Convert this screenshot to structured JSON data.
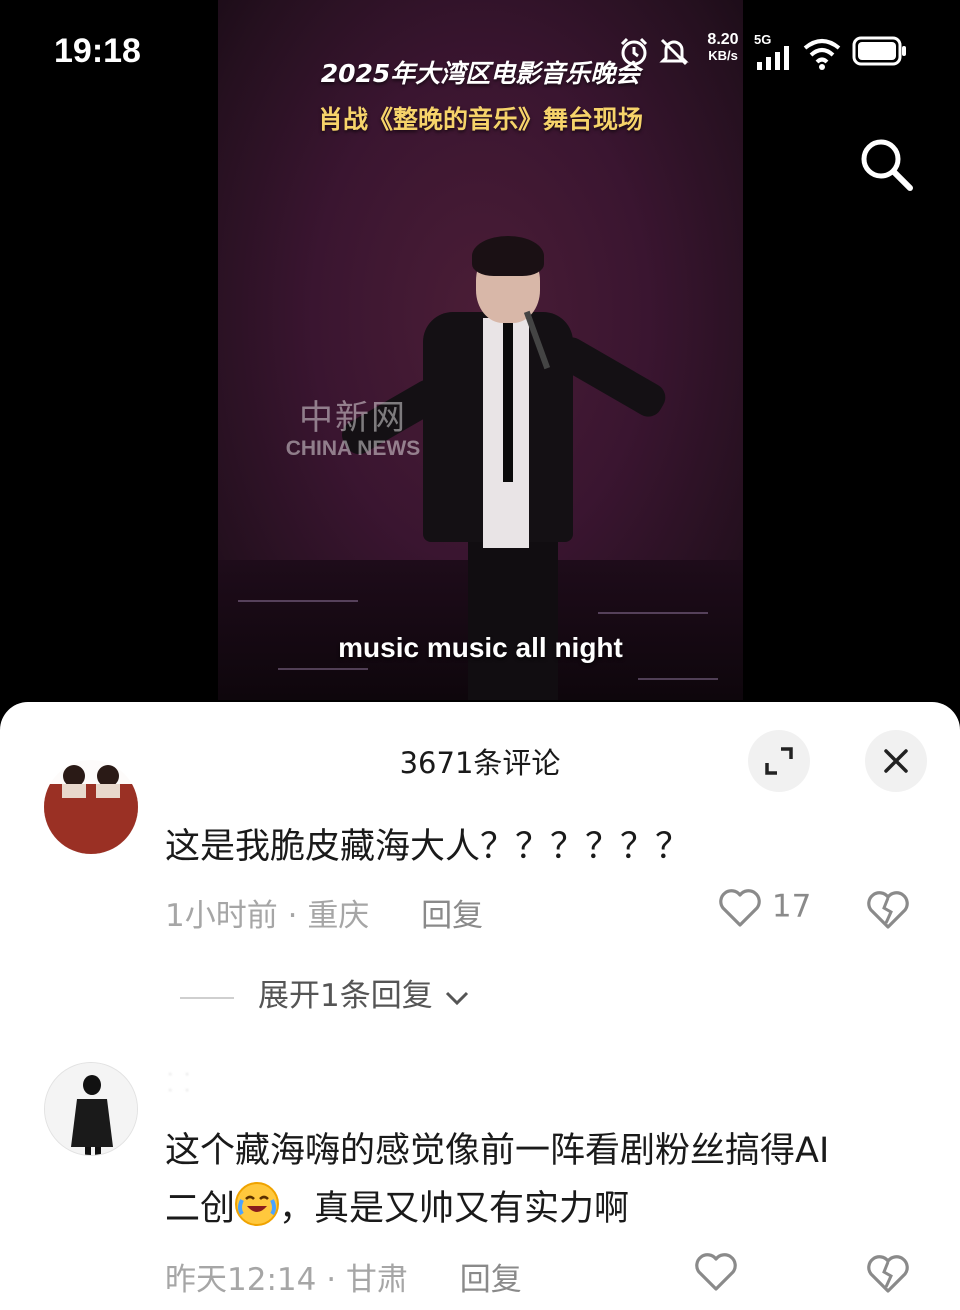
{
  "status_bar": {
    "time": "19:18",
    "net_speed_value": "8.20",
    "net_speed_unit": "KB/s",
    "network": "5G",
    "icons": [
      "alarm-icon",
      "mute-icon",
      "signal-icon",
      "wifi-icon",
      "battery-icon"
    ]
  },
  "video": {
    "title_line1": "2025年大湾区电影音乐晚会",
    "title_line2": "肖战《整晚的音乐》舞台现场",
    "watermark_cn": "中新网",
    "watermark_en": "CHINA NEWS",
    "subtitle": "music music all night",
    "title_colors": {
      "line1": "#ffffff",
      "line2": "#f6d36a"
    }
  },
  "comments_panel": {
    "title": "3671条评论",
    "expand_icon": "expand-icon",
    "close_icon": "close-icon",
    "comments": [
      {
        "text": "这是我脆皮藏海大人？？？？？？",
        "time": "1小时前",
        "location": "重庆",
        "reply_label": "回复",
        "likes": "17",
        "expand_replies": "展开1条回复"
      },
      {
        "text_line1": "这个藏海嗨的感觉像前一阵看剧粉丝搞得AI",
        "text_line2_before": "二创",
        "emoji": "laughing-crying-emoji",
        "text_line2_after": "，真是又帅又有实力啊",
        "time": "昨天12:14",
        "location": "甘肃",
        "reply_label": "回复"
      }
    ]
  }
}
